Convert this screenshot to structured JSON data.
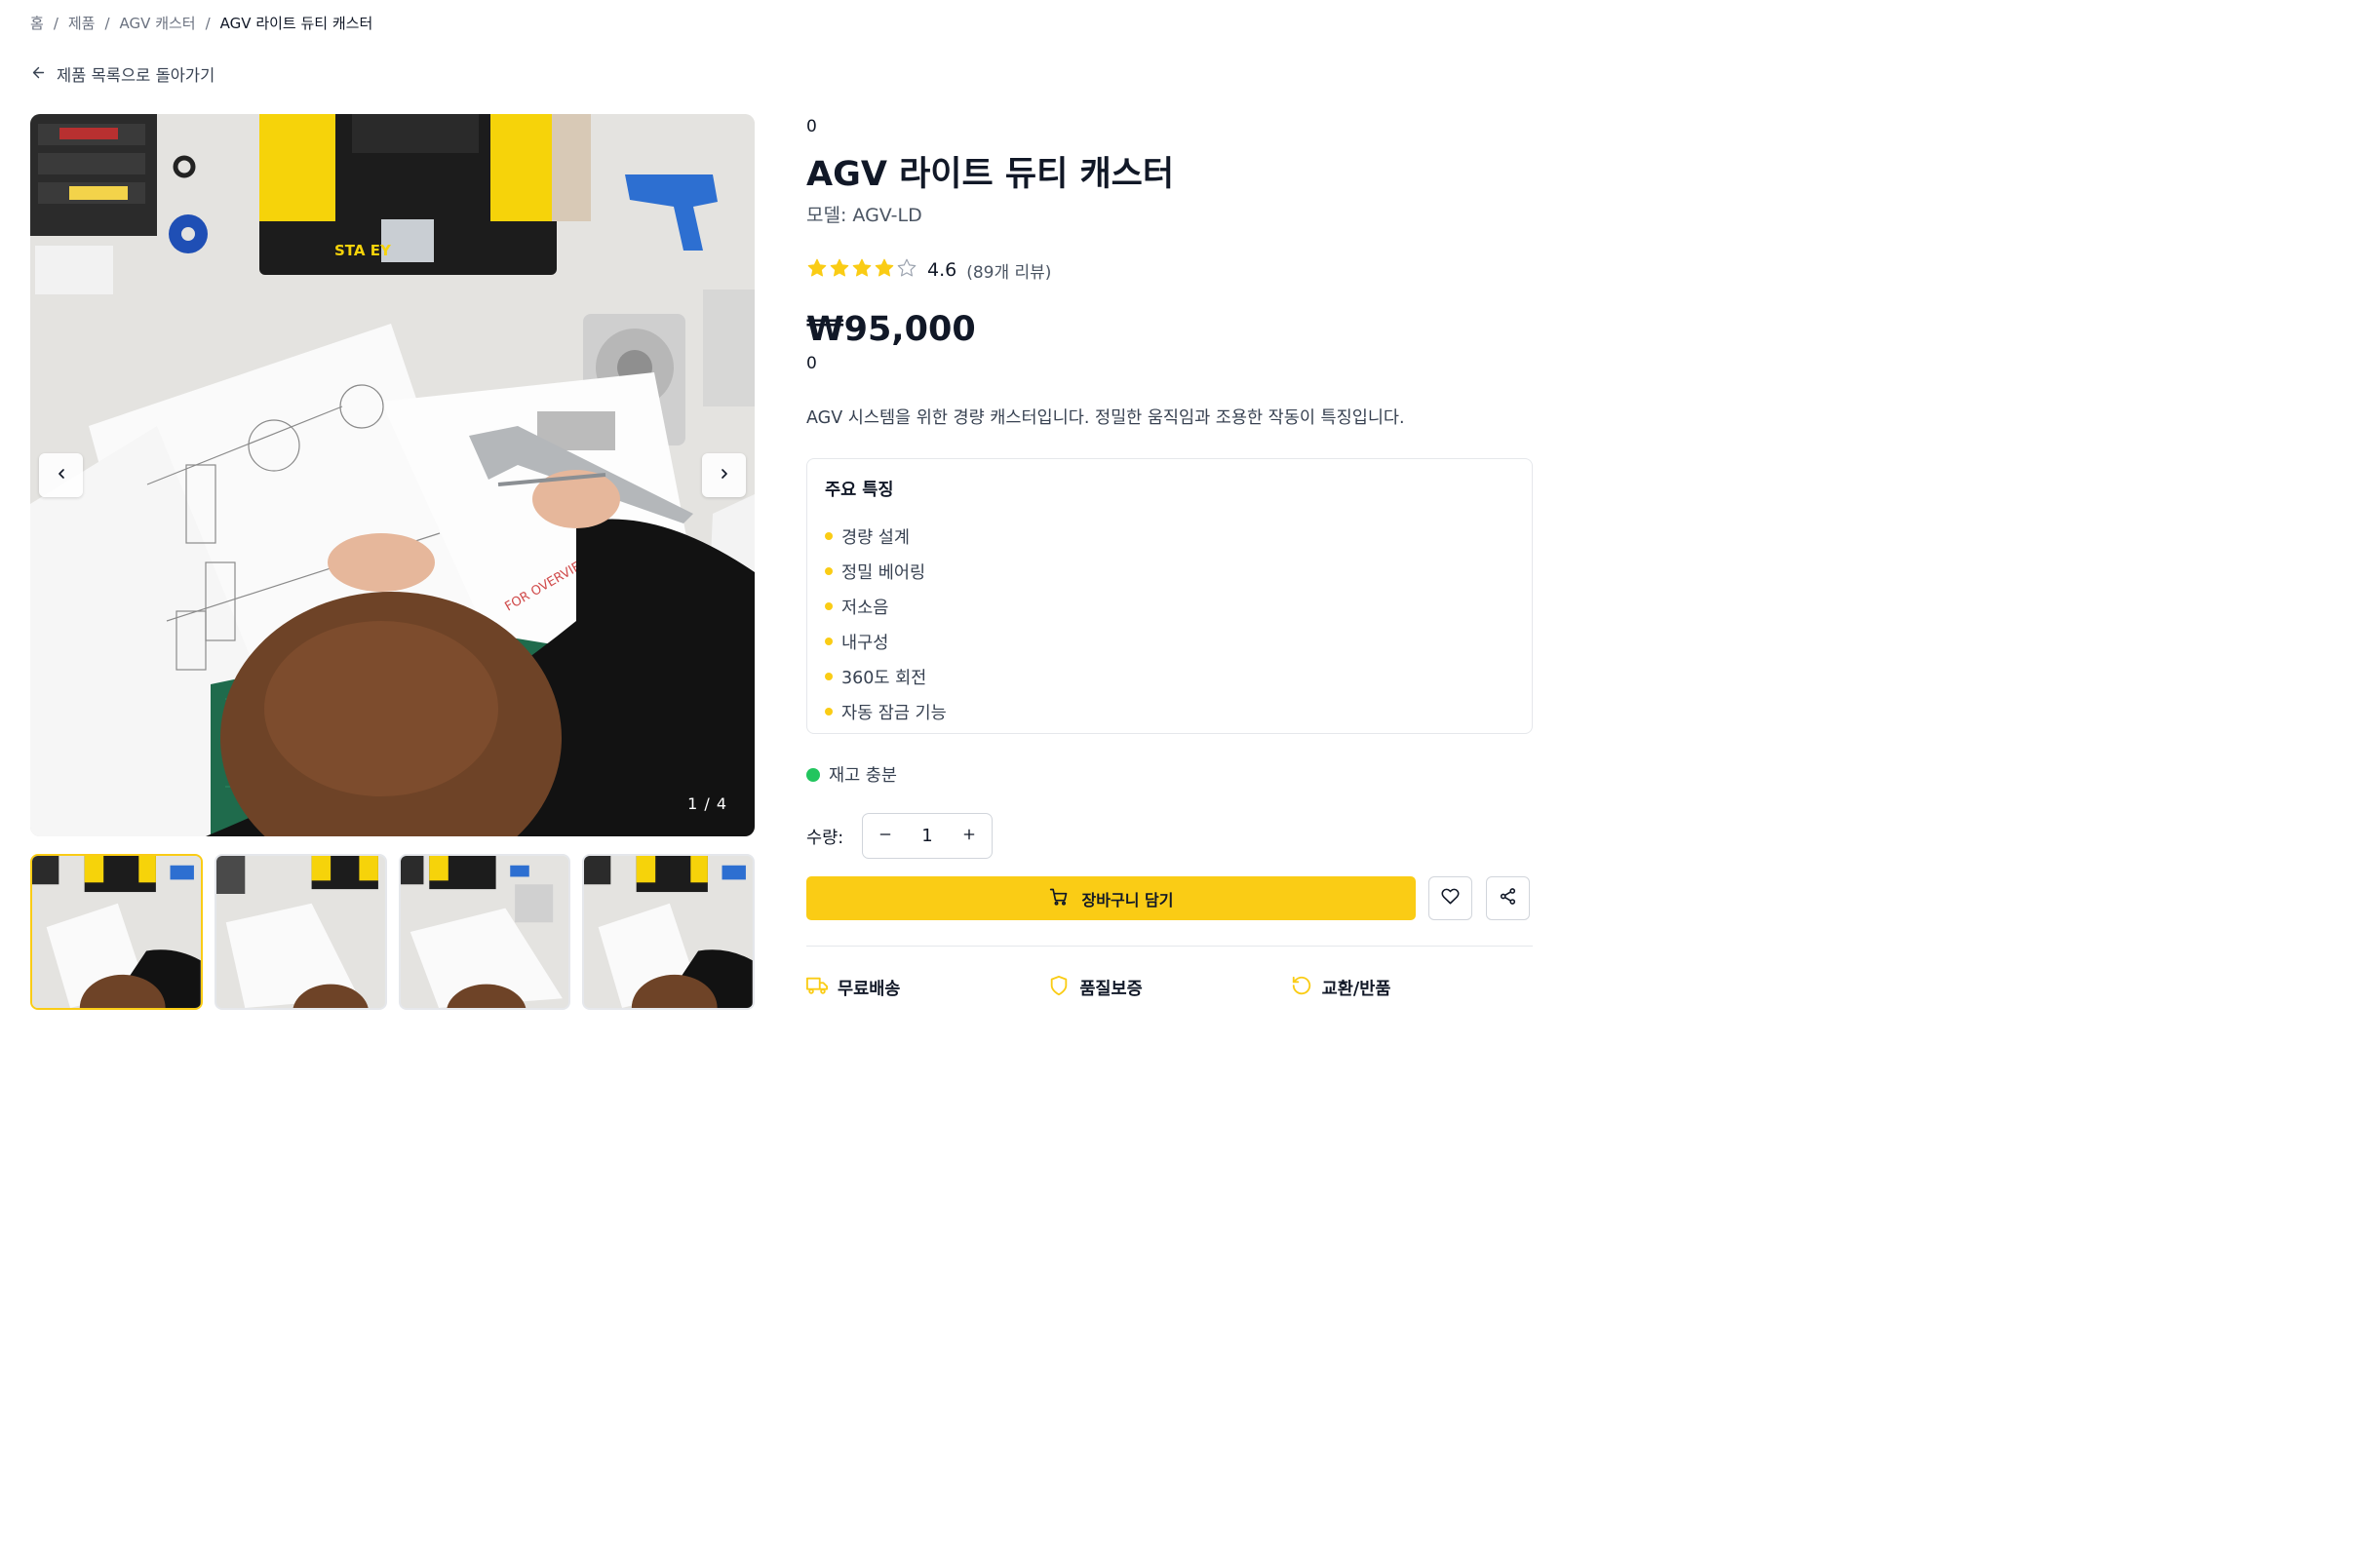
{
  "breadcrumb": {
    "home": "홈",
    "products": "제품",
    "category": "AGV 캐스터",
    "current": "AGV 라이트 듀티 캐스터",
    "separator": "/"
  },
  "back_link": {
    "label": "제품 목록으로 돌아가기",
    "icon": "arrow-left-icon"
  },
  "gallery": {
    "counter": "1 / 4",
    "prev_icon": "chevron-left-icon",
    "next_icon": "chevron-right-icon",
    "thumbnail_count": 4,
    "active_thumbnail": 1
  },
  "product": {
    "category_line": "0",
    "title": "AGV 라이트 듀티 캐스터",
    "model": "모델: AGV-LD",
    "rating": 4.6,
    "rating_text": "4.6",
    "stars_filled": 4,
    "stars_total": 5,
    "review_count": "(89개 리뷰)",
    "price": "₩95,000",
    "price_sub": "0",
    "description": "AGV 시스템을 위한 경량 캐스터입니다. 정밀한 움직임과 조용한 작동이 특징입니다."
  },
  "features": {
    "title": "주요 특징",
    "items": [
      "경량 설계",
      "정밀 베어링",
      "저소음",
      "내구성",
      "360도 회전",
      "자동 잠금 기능"
    ]
  },
  "stock": {
    "label": "재고 충분",
    "color": "#22c55e"
  },
  "quantity": {
    "label": "수량:",
    "value": "1",
    "minus_icon": "minus-icon",
    "plus_icon": "plus-icon"
  },
  "actions": {
    "cart_label": "장바구니 담기",
    "cart_icon": "cart-icon",
    "wishlist_icon": "heart-icon",
    "share_icon": "share-icon"
  },
  "benefits": [
    {
      "label": "무료배송",
      "icon": "truck-icon"
    },
    {
      "label": "품질보증",
      "icon": "shield-icon"
    },
    {
      "label": "교환/반품",
      "icon": "return-icon"
    }
  ],
  "colors": {
    "accent": "#facc15",
    "text": "#111827",
    "muted": "#6b7280",
    "border": "#e5e7eb"
  }
}
